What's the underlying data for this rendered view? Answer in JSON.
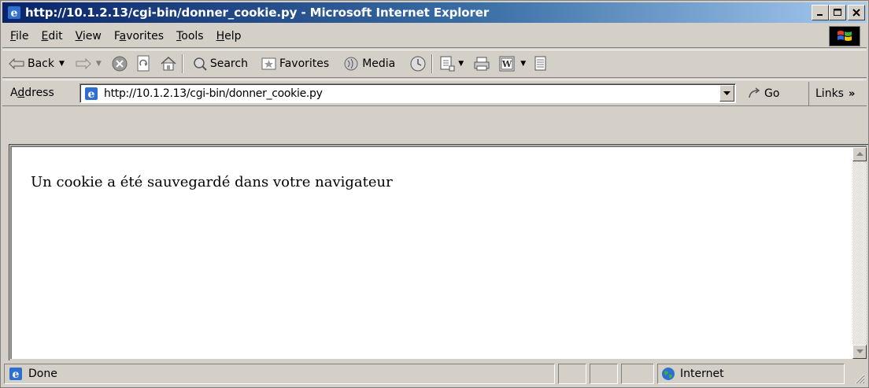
{
  "window": {
    "title": "http://10.1.2.13/cgi-bin/donner_cookie.py - Microsoft Internet Explorer"
  },
  "menu": {
    "items": [
      {
        "label_u": "F",
        "label_rest": "ile"
      },
      {
        "label_u": "E",
        "label_rest": "dit"
      },
      {
        "label_u": "V",
        "label_rest": "iew"
      },
      {
        "label_pre": "F",
        "label_u": "a",
        "label_rest": "vorites"
      },
      {
        "label_u": "T",
        "label_rest": "ools"
      },
      {
        "label_u": "H",
        "label_rest": "elp"
      }
    ]
  },
  "toolbar": {
    "back_label": "Back",
    "search_label": "Search",
    "favorites_label": "Favorites",
    "media_label": "Media"
  },
  "address": {
    "label_pre": "A",
    "label_u": "d",
    "label_rest": "dress",
    "url": "http://10.1.2.13/cgi-bin/donner_cookie.py",
    "go_label": "Go",
    "links_label": "Links"
  },
  "content": {
    "message": "Un cookie a été sauvegardé dans votre navigateur"
  },
  "status": {
    "text": "Done",
    "zone": "Internet"
  },
  "colors": {
    "titlebar_start": "#0a246a",
    "titlebar_end": "#a6caf0",
    "chrome": "#d4d0c8"
  }
}
